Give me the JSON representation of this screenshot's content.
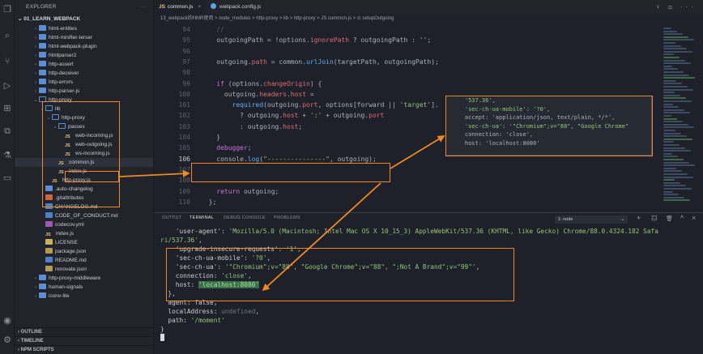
{
  "activity": {
    "icons": [
      "files-icon",
      "search-icon",
      "source-control-icon",
      "run-debug-icon",
      "extensions-icon",
      "remote-icon",
      "testing-icon",
      "docker-icon",
      "account-icon",
      "settings-icon"
    ]
  },
  "sidebar": {
    "title": "EXPLORER",
    "more": "···",
    "root": "01_LEARN_WEBPACK",
    "items": [
      {
        "label": "html-entities",
        "type": "folder",
        "depth": 2,
        "open": false
      },
      {
        "label": "html-minifier-terser",
        "type": "folder",
        "depth": 2,
        "open": false
      },
      {
        "label": "html-webpack-plugin",
        "type": "folder",
        "depth": 2,
        "open": false
      },
      {
        "label": "htmlparser2",
        "type": "folder",
        "depth": 2,
        "open": false
      },
      {
        "label": "http-assert",
        "type": "folder",
        "depth": 2,
        "open": false
      },
      {
        "label": "http-deceiver",
        "type": "folder",
        "depth": 2,
        "open": false
      },
      {
        "label": "http-errors",
        "type": "folder",
        "depth": 2,
        "open": false
      },
      {
        "label": "http-parser-js",
        "type": "folder",
        "depth": 2,
        "open": false
      },
      {
        "label": "http-proxy",
        "type": "folder",
        "depth": 2,
        "open": true
      },
      {
        "label": "lib",
        "type": "folder",
        "depth": 3,
        "open": true
      },
      {
        "label": "http-proxy",
        "type": "folder",
        "depth": 4,
        "open": true
      },
      {
        "label": "passes",
        "type": "folder",
        "depth": 5,
        "open": true
      },
      {
        "label": "web-incoming.js",
        "type": "js",
        "depth": 6
      },
      {
        "label": "web-outgoing.js",
        "type": "js",
        "depth": 6
      },
      {
        "label": "ws-incoming.js",
        "type": "js",
        "depth": 6
      },
      {
        "label": "common.js",
        "type": "js",
        "depth": 5,
        "selected": true
      },
      {
        "label": "index.js",
        "type": "js",
        "depth": 5
      },
      {
        "label": "http-proxy.js",
        "type": "js",
        "depth": 4
      },
      {
        "label": ".auto-changelog",
        "type": "folderfile",
        "depth": 3
      },
      {
        "label": ".gitattributes",
        "type": "git",
        "depth": 3
      },
      {
        "label": "CHANGELOG.md",
        "type": "md",
        "depth": 3
      },
      {
        "label": "CODE_OF_CONDUCT.md",
        "type": "md",
        "depth": 3
      },
      {
        "label": "codecov.yml",
        "type": "yml",
        "depth": 3
      },
      {
        "label": "index.js",
        "type": "js",
        "depth": 3
      },
      {
        "label": "LICENSE",
        "type": "lic",
        "depth": 3
      },
      {
        "label": "package.json",
        "type": "json",
        "depth": 3
      },
      {
        "label": "README.md",
        "type": "md",
        "depth": 3
      },
      {
        "label": "renovate.json",
        "type": "json",
        "depth": 3
      },
      {
        "label": "http-proxy-middleware",
        "type": "folder",
        "depth": 2,
        "open": false
      },
      {
        "label": "human-signals",
        "type": "folder",
        "depth": 2,
        "open": false
      },
      {
        "label": "iconv-lite",
        "type": "folder",
        "depth": 2,
        "open": false
      }
    ],
    "sections": [
      "OUTLINE",
      "TIMELINE",
      "NPM SCRIPTS"
    ]
  },
  "tabs": [
    {
      "prefix": "JS",
      "label": "common.js",
      "close": "×",
      "active": true
    },
    {
      "label": "webpack.config.js",
      "active": false
    }
  ],
  "tab_actions": "⑂ ◫ ···",
  "breadcrumb": "13_webpack的HMR使用 > node_modules > http-proxy > lib > http-proxy > JS common.js > ⊙ setupOutgoing",
  "editor": {
    "lines": [
      {
        "n": "94",
        "tokens": [
          {
            "t": "    //",
            "c": "cm"
          }
        ]
      },
      {
        "n": "95",
        "tokens": [
          {
            "t": "    outgoingPath = !options.",
            "c": ""
          },
          {
            "t": "ignorePath",
            "c": "prop"
          },
          {
            "t": " ? outgoingPath : '';",
            "c": ""
          }
        ]
      },
      {
        "n": "96",
        "tokens": []
      },
      {
        "n": "97",
        "tokens": [
          {
            "t": "    outgoing.",
            "c": ""
          },
          {
            "t": "path",
            "c": "prop"
          },
          {
            "t": " = common.",
            "c": ""
          },
          {
            "t": "urlJoin",
            "c": "fn"
          },
          {
            "t": "(targetPath, outgoingPath);",
            "c": ""
          }
        ]
      },
      {
        "n": "98",
        "tokens": []
      },
      {
        "n": "99",
        "tokens": [
          {
            "t": "    if",
            "c": "kw"
          },
          {
            "t": " (options.",
            "c": ""
          },
          {
            "t": "changeOrigin",
            "c": "prop"
          },
          {
            "t": ") {",
            "c": ""
          }
        ]
      },
      {
        "n": "100",
        "tokens": [
          {
            "t": "      outgoing.",
            "c": ""
          },
          {
            "t": "headers",
            "c": "prop"
          },
          {
            "t": ".",
            "c": ""
          },
          {
            "t": "host",
            "c": "prop"
          },
          {
            "t": " =",
            "c": ""
          }
        ]
      },
      {
        "n": "101",
        "tokens": [
          {
            "t": "        required",
            "c": "fn"
          },
          {
            "t": "(outgoing.",
            "c": ""
          },
          {
            "t": "port",
            "c": "prop"
          },
          {
            "t": ", options[forward || ",
            "c": ""
          },
          {
            "t": "'target'",
            "c": "str"
          },
          {
            "t": "].",
            "c": ""
          }
        ]
      },
      {
        "n": "102",
        "tokens": [
          {
            "t": "          ? outgoing.",
            "c": ""
          },
          {
            "t": "host",
            "c": "prop"
          },
          {
            "t": " + ",
            "c": ""
          },
          {
            "t": "':'",
            "c": "str"
          },
          {
            "t": " + outgoing.",
            "c": ""
          },
          {
            "t": "port",
            "c": "prop"
          }
        ]
      },
      {
        "n": "103",
        "tokens": [
          {
            "t": "          : outgoing.",
            "c": ""
          },
          {
            "t": "host",
            "c": "prop"
          },
          {
            "t": ";",
            "c": ""
          }
        ]
      },
      {
        "n": "104",
        "tokens": [
          {
            "t": "    }",
            "c": ""
          }
        ]
      },
      {
        "n": "105",
        "tokens": [
          {
            "t": "    debugger",
            "c": "kw"
          },
          {
            "t": ";",
            "c": ""
          }
        ]
      },
      {
        "n": "106",
        "tokens": [
          {
            "t": "    console.",
            "c": ""
          },
          {
            "t": "log",
            "c": "fn"
          },
          {
            "t": "(",
            "c": ""
          },
          {
            "t": "\"---------------\"",
            "c": "str"
          },
          {
            "t": ", outgoing);",
            "c": ""
          }
        ]
      },
      {
        "n": "107",
        "tokens": []
      },
      {
        "n": "108",
        "tokens": []
      },
      {
        "n": "109",
        "tokens": [
          {
            "t": "    return",
            "c": "kw"
          },
          {
            "t": " outgoing;",
            "c": ""
          }
        ]
      },
      {
        "n": "110",
        "tokens": [
          {
            "t": "  };",
            "c": ""
          }
        ]
      }
    ]
  },
  "hover": {
    "lines": [
      {
        "t": "    '537.36',",
        "c": "hs"
      },
      {
        "t": "    'sec-ch-ua-mobile': '?0',",
        "c": "hs"
      },
      {
        "t": "    accept: 'application/json, text/plain, */*',",
        "c": "hp"
      },
      {
        "t": "    'sec-ch-ua': '\"Chromium\";v=\"88\", \"Google Chrome\"",
        "c": "hs"
      },
      {
        "t": "    connection: 'close',",
        "c": "hp"
      },
      {
        "t": "    host: 'localhost:8080'",
        "c": "hp"
      }
    ]
  },
  "panel": {
    "tabs": [
      "OUTPUT",
      "TERMINAL",
      "DEBUG CONSOLE",
      "PROBLEMS"
    ],
    "active_tab": "TERMINAL",
    "terminal_select": "1: node",
    "actions": [
      "+",
      "⊡",
      "🗑",
      "^",
      "×"
    ],
    "lines": [
      {
        "parts": [
          {
            "t": "    'user-agent': ",
            "c": ""
          },
          {
            "t": "'Mozilla/5.0 (Macintosh; Intel Mac OS X 10_15_3) AppleWebKit/537.36 (KHTML, like Gecko) Chrome/88.0.4324.182 Safa",
            "c": "s"
          }
        ]
      },
      {
        "parts": [
          {
            "t": "ri/537.36'",
            "c": "s"
          },
          {
            "t": ",",
            "c": ""
          }
        ]
      },
      {
        "parts": [
          {
            "t": "    'upgrade-insecure-requests': ",
            "c": ""
          },
          {
            "t": "'1'",
            "c": "s"
          },
          {
            "t": ",",
            "c": ""
          }
        ]
      },
      {
        "parts": [
          {
            "t": "    'sec-ch-ua-mobile': ",
            "c": ""
          },
          {
            "t": "'?0'",
            "c": "s"
          },
          {
            "t": ",",
            "c": ""
          }
        ]
      },
      {
        "parts": [
          {
            "t": "    'sec-ch-ua': ",
            "c": ""
          },
          {
            "t": "'\"Chromium\";v=\"88\", \"Google Chrome\";v=\"88\", \";Not A Brand\";v=\"99\"'",
            "c": "s"
          },
          {
            "t": ",",
            "c": ""
          }
        ]
      },
      {
        "parts": [
          {
            "t": "    connection: ",
            "c": ""
          },
          {
            "t": "'close'",
            "c": "s"
          },
          {
            "t": ",",
            "c": ""
          }
        ]
      },
      {
        "parts": [
          {
            "t": "    host: ",
            "c": ""
          },
          {
            "t": "'localhost:8080'",
            "c": "hl"
          }
        ]
      },
      {
        "parts": [
          {
            "t": "  },",
            "c": ""
          }
        ]
      },
      {
        "parts": [
          {
            "t": "  agent: false,",
            "c": ""
          }
        ]
      },
      {
        "parts": [
          {
            "t": "  localAddress: ",
            "c": ""
          },
          {
            "t": "undefined",
            "c": "gray"
          },
          {
            "t": ",",
            "c": ""
          }
        ]
      },
      {
        "parts": [
          {
            "t": "  path: ",
            "c": ""
          },
          {
            "t": "'/moment'",
            "c": "s"
          }
        ]
      },
      {
        "parts": [
          {
            "t": "}",
            "c": ""
          }
        ]
      }
    ]
  }
}
